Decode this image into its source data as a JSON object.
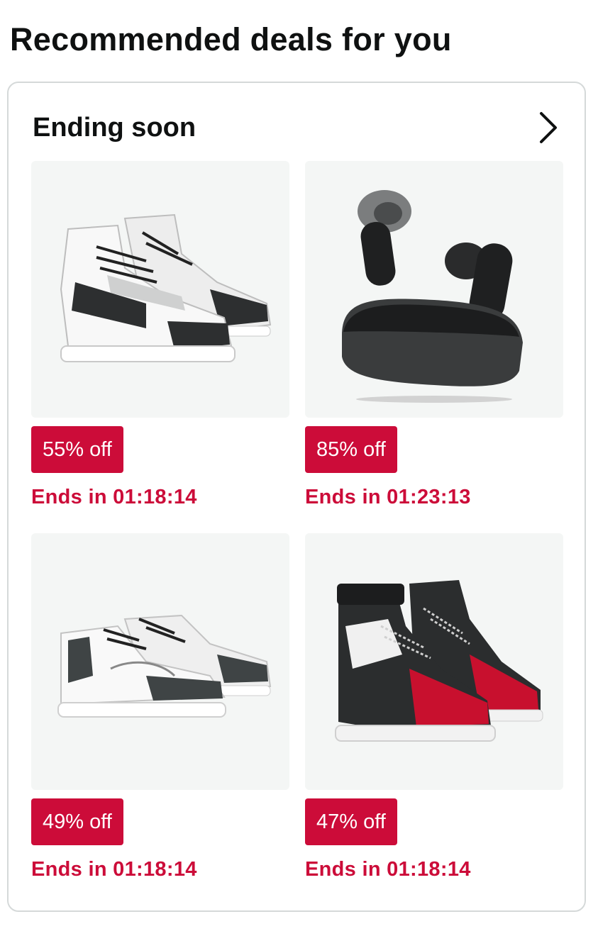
{
  "page": {
    "title": "Recommended deals for you"
  },
  "section": {
    "title": "Ending soon",
    "chevron_icon": "chevron-right-icon"
  },
  "deals": [
    {
      "product": "white-black-high-top-sneaker",
      "badge": "55% off",
      "timer": "Ends in 01:18:14"
    },
    {
      "product": "black-wireless-earbuds",
      "badge": "85% off",
      "timer": "Ends in 01:23:13"
    },
    {
      "product": "white-grey-low-top-sneaker",
      "badge": "49% off",
      "timer": "Ends in 01:18:14"
    },
    {
      "product": "black-red-high-top-sneaker",
      "badge": "47% off",
      "timer": "Ends in 01:18:14"
    }
  ],
  "colors": {
    "badge_bg": "#cc0c39",
    "timer_text": "#cc0c39",
    "image_bg": "#f4f6f5",
    "card_border": "#d5d9d9"
  }
}
